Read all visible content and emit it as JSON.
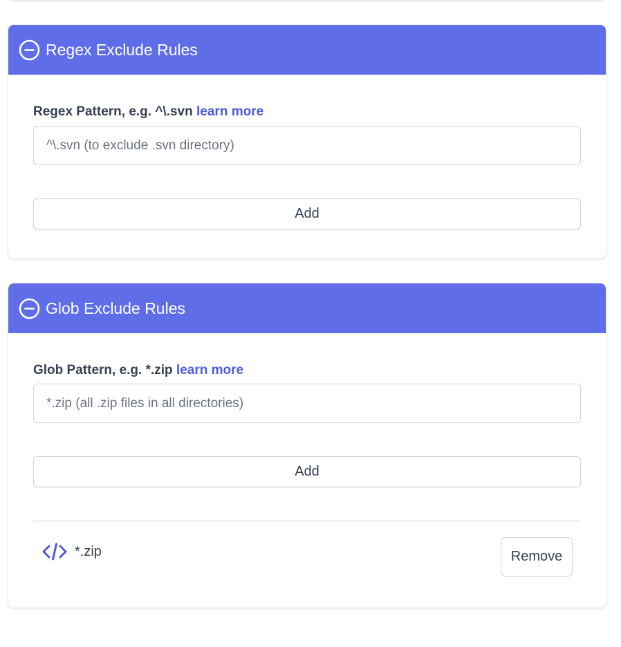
{
  "regex": {
    "title": "Regex Exclude Rules",
    "label": "Regex Pattern, e.g. ^\\.svn",
    "learn_more": "learn more",
    "placeholder": "^\\.svn (to exclude .svn directory)",
    "add_label": "Add",
    "icon": "minus-circle-icon"
  },
  "glob": {
    "title": "Glob Exclude Rules",
    "label": "Glob Pattern, e.g. *.zip",
    "learn_more": "learn more",
    "placeholder": "*.zip (all .zip files in all directories)",
    "add_label": "Add",
    "icon": "minus-circle-icon",
    "rules": [
      {
        "pattern": "*.zip",
        "icon": "code-icon",
        "remove_label": "Remove"
      }
    ]
  },
  "colors": {
    "header_bg": "#5f6ee8",
    "accent": "#4f5bd5",
    "border": "#d1d5db"
  }
}
